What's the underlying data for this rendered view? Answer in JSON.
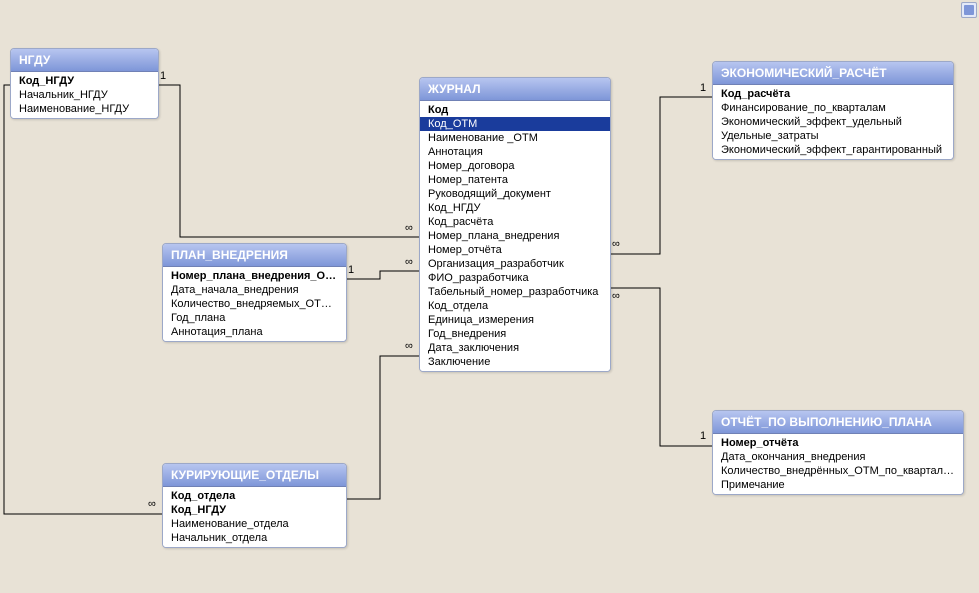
{
  "entities": {
    "ngdu": {
      "title": "НГДУ",
      "fields": [
        {
          "label": "Код_НГДУ",
          "pk": true
        },
        {
          "label": "Начальник_НГДУ"
        },
        {
          "label": "Наименование_НГДУ"
        }
      ]
    },
    "plan": {
      "title": "ПЛАН_ВНЕДРЕНИЯ",
      "fields": [
        {
          "label": "Номер_плана_внедрения_ОТМ",
          "pk": true
        },
        {
          "label": "Дата_начала_внедрения"
        },
        {
          "label": "Количество_внедряемых_ОТМ_по_кв"
        },
        {
          "label": "Год_плана"
        },
        {
          "label": "Аннотация_плана"
        }
      ]
    },
    "dept": {
      "title": "КУРИРУЮЩИЕ_ОТДЕЛЫ",
      "fields": [
        {
          "label": "Код_отдела",
          "pk": true
        },
        {
          "label": "Код_НГДУ",
          "pk": true
        },
        {
          "label": "Наименование_отдела"
        },
        {
          "label": "Начальник_отдела"
        }
      ]
    },
    "journal": {
      "title": "ЖУРНАЛ",
      "fields": [
        {
          "label": "Код",
          "pk": true
        },
        {
          "label": "Код_ОТМ",
          "selected": true
        },
        {
          "label": "Наименование _ОТМ"
        },
        {
          "label": "Аннотация"
        },
        {
          "label": "Номер_договора"
        },
        {
          "label": "Номер_патента"
        },
        {
          "label": "Руководящий_документ"
        },
        {
          "label": "Код_НГДУ"
        },
        {
          "label": "Код_расчёта"
        },
        {
          "label": "Номер_плана_внедрения"
        },
        {
          "label": "Номер_отчёта"
        },
        {
          "label": "Организация_разработчик"
        },
        {
          "label": "ФИО_разработчика"
        },
        {
          "label": "Табельный_номер_разработчика"
        },
        {
          "label": "Код_отдела"
        },
        {
          "label": "Единица_измерения"
        },
        {
          "label": "Год_внедрения"
        },
        {
          "label": "Дата_заключения"
        },
        {
          "label": "Заключение"
        }
      ]
    },
    "econ": {
      "title": "ЭКОНОМИЧЕСКИЙ_РАСЧЁТ",
      "fields": [
        {
          "label": "Код_расчёта",
          "pk": true
        },
        {
          "label": "Финансирование_по_кварталам"
        },
        {
          "label": "Экономический_эффект_удельный"
        },
        {
          "label": "Удельные_затраты"
        },
        {
          "label": "Экономический_эффект_гарантированный"
        }
      ]
    },
    "report": {
      "title": "ОТЧЁТ_ПО ВЫПОЛНЕНИЮ_ПЛАНА",
      "fields": [
        {
          "label": "Номер_отчёта",
          "pk": true
        },
        {
          "label": "Дата_окончания_внедрения"
        },
        {
          "label": "Количество_внедрённых_ОТМ_по_кварталам"
        },
        {
          "label": "Примечание"
        }
      ]
    }
  },
  "labels": {
    "one_ngdu": "1",
    "one_plan": "1",
    "one_econ": "1",
    "one_report": "1",
    "inf_j_ngdu": "∞",
    "inf_j_plan": "∞",
    "inf_j_econ": "∞",
    "inf_j_report": "∞",
    "inf_j_dept": "∞",
    "inf_dept": "∞"
  }
}
